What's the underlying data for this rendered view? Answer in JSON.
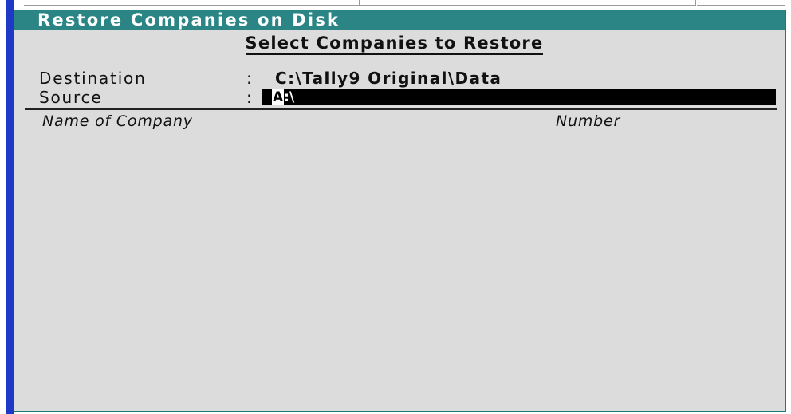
{
  "window": {
    "title": "Restore Companies on Disk"
  },
  "form": {
    "heading": "Select Companies to Restore",
    "destination_label": "Destination",
    "destination_value": "C:\\Tally9 Original\\Data",
    "source_label": "Source",
    "source_value_cursor": "A",
    "source_value_rest": ":\\",
    "separator": ":"
  },
  "table": {
    "columns": [
      "Name of Company",
      "Number"
    ]
  },
  "colors": {
    "title_bar": "#2b8585",
    "panel_bg": "#dcdcdc",
    "left_accent": "#1f39c7",
    "input_bg": "#000000"
  }
}
